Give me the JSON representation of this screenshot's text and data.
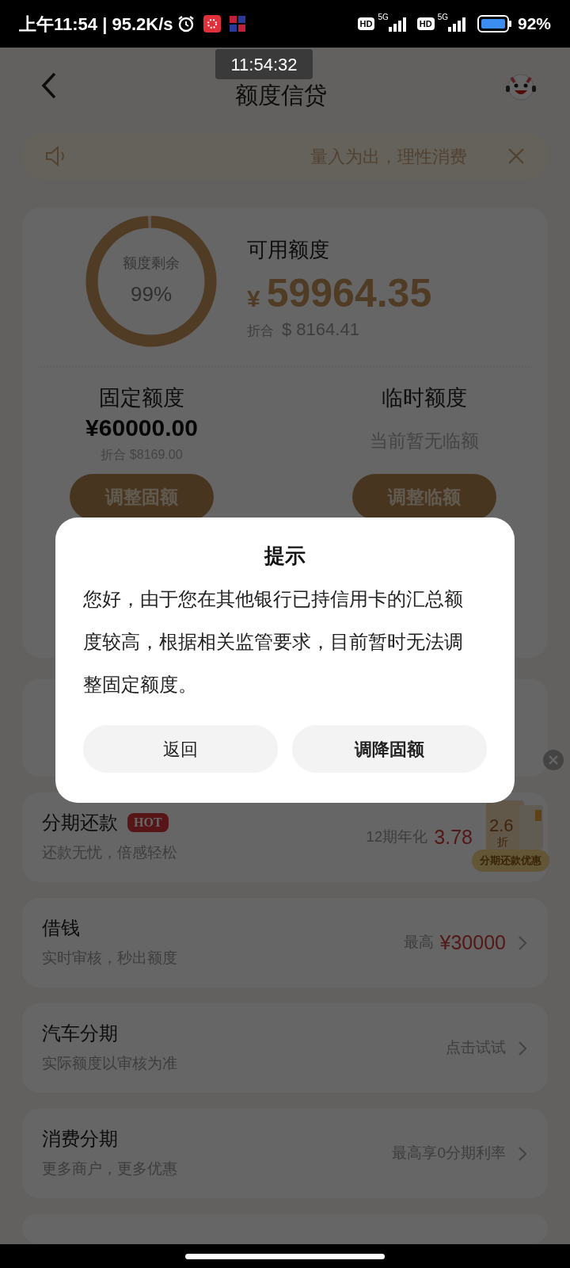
{
  "status_bar": {
    "time_speed": "上午11:54 | 95.2K/s",
    "sims": [
      {
        "hd": "HD",
        "net": "5G"
      },
      {
        "hd": "HD",
        "net": "5G"
      }
    ],
    "battery": "92%"
  },
  "time_overlay": "11:54:32",
  "header": {
    "title": "额度信贷"
  },
  "notice": {
    "text": "量入为出，理性消费"
  },
  "credit_card": {
    "ring": {
      "label": "额度剩余",
      "percent": "99%",
      "level": 0.99
    },
    "available": {
      "label": "可用额度",
      "currency": "¥",
      "amount": "59964.35",
      "converted_label": "折合",
      "converted": "$ 8164.41"
    },
    "fixed": {
      "label": "固定额度",
      "amount": "¥60000.00",
      "converted": "折合 $8169.00",
      "button": "调整固额"
    },
    "temporary": {
      "label": "临时额度",
      "note": "当前暂无临额",
      "button": "调整临额"
    }
  },
  "rows": [
    {
      "chevron": false
    },
    {
      "title": "分期还款",
      "badge": "HOT",
      "subtitle": "还款无忧，倍感轻松",
      "hint": "12期年化",
      "highlight": "3.78",
      "chevron": false
    },
    {
      "title": "借钱",
      "subtitle": "实时审核，秒出额度",
      "hint": "最高",
      "highlight": "¥30000",
      "chevron": true
    },
    {
      "title": "汽车分期",
      "subtitle": "实际额度以审核为准",
      "hint": "点击试试",
      "chevron": true
    },
    {
      "title": "消费分期",
      "subtitle": "更多商户，更多优惠",
      "hint": "最高享0分期利率",
      "chevron": true
    },
    {
      "chevron": false
    }
  ],
  "promo_badge": {
    "discount": "2.6",
    "unit": "折",
    "label": "分期还款优惠"
  },
  "dialog": {
    "title": "提示",
    "message": "您好，由于您在其他银行已持信用卡的汇总额度较高，根据相关监管要求，目前暂时无法调整固定额度。",
    "buttons": [
      {
        "label": "返回",
        "primary": false
      },
      {
        "label": "调降固额",
        "primary": true
      }
    ]
  }
}
